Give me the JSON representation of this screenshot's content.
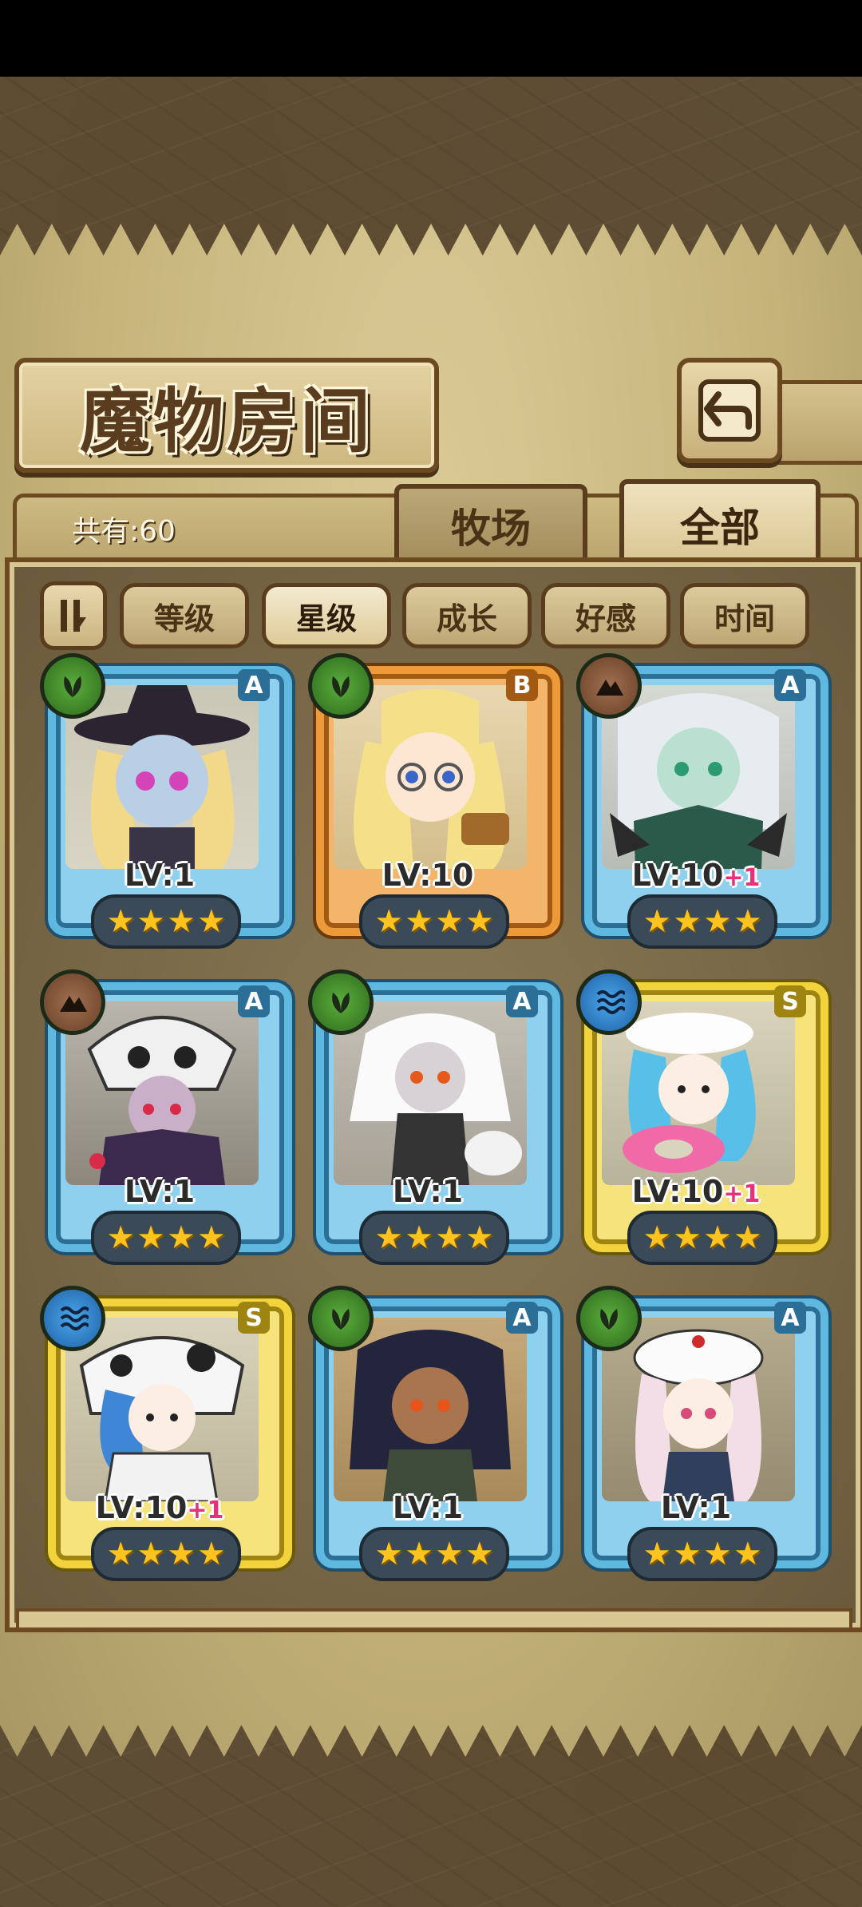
{
  "header": {
    "title": "魔物房间",
    "count_label": "共有:60"
  },
  "tabs": [
    {
      "label": "牧场",
      "active": false
    },
    {
      "label": "全部",
      "active": true
    }
  ],
  "sort_buttons": [
    {
      "label": "等级",
      "active": false
    },
    {
      "label": "星级",
      "active": true
    },
    {
      "label": "成长",
      "active": false
    },
    {
      "label": "好感",
      "active": false
    },
    {
      "label": "时间",
      "active": false
    }
  ],
  "colors": {
    "frame_a": "#5fb8e0",
    "frame_b": "#ec9a3a",
    "frame_s": "#f2d33b",
    "star": "#ffc31f",
    "plus": "#e8317a"
  },
  "monsters": [
    {
      "rank": "A",
      "element": "nature-icon",
      "level": "LV:1",
      "plus": "",
      "stars": 4
    },
    {
      "rank": "B",
      "element": "nature-icon",
      "level": "LV:10",
      "plus": "",
      "stars": 4
    },
    {
      "rank": "A",
      "element": "earth-icon",
      "level": "LV:10",
      "plus": "+1",
      "stars": 4
    },
    {
      "rank": "A",
      "element": "earth-icon",
      "level": "LV:1",
      "plus": "",
      "stars": 4
    },
    {
      "rank": "A",
      "element": "nature-icon",
      "level": "LV:1",
      "plus": "",
      "stars": 4
    },
    {
      "rank": "S",
      "element": "water-icon",
      "level": "LV:10",
      "plus": "+1",
      "stars": 4
    },
    {
      "rank": "S",
      "element": "water-icon",
      "level": "LV:10",
      "plus": "+1",
      "stars": 4
    },
    {
      "rank": "A",
      "element": "nature-icon",
      "level": "LV:1",
      "plus": "",
      "stars": 4
    },
    {
      "rank": "A",
      "element": "nature-icon",
      "level": "LV:1",
      "plus": "",
      "stars": 4
    }
  ]
}
